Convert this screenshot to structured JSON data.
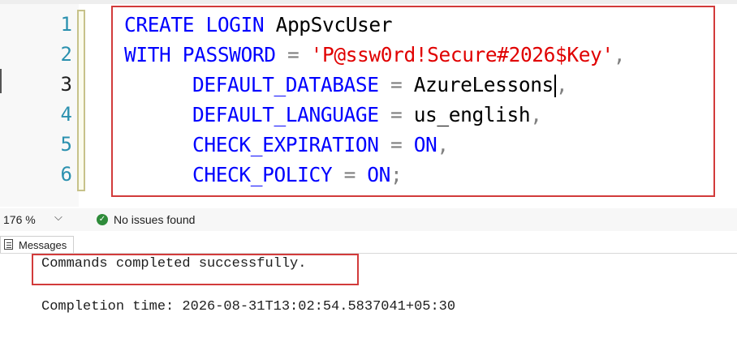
{
  "editor": {
    "line_numbers": [
      "1",
      "2",
      "3",
      "4",
      "5",
      "6"
    ],
    "current_line": "3",
    "lines": [
      {
        "kw1": "CREATE",
        "kw2": "LOGIN",
        "ident": "AppSvcUser"
      },
      {
        "kw1": "WITH",
        "kw2": "PASSWORD",
        "op": "=",
        "string": "'P@ssw0rd!Secure#2026$Key'",
        "comma": ","
      },
      {
        "option": "DEFAULT_DATABASE",
        "op": "=",
        "value": "AzureLessons",
        "comma": ","
      },
      {
        "option": "DEFAULT_LANGUAGE",
        "op": "=",
        "value": "us_english",
        "comma": ","
      },
      {
        "option": "CHECK_EXPIRATION",
        "op": "=",
        "value": "ON",
        "comma": ","
      },
      {
        "option": "CHECK_POLICY",
        "op": "=",
        "value": "ON",
        "terminator": ";"
      }
    ]
  },
  "status_bar": {
    "zoom": "176 %",
    "zoom_chevron": "⌵",
    "issues_icon_glyph": "✓",
    "issues_text": "No issues found"
  },
  "messages": {
    "tab_label": "Messages",
    "result_text": "Commands completed successfully.",
    "completion_text": "Completion time: 2026-08-31T13:02:54.5837041+05:30"
  },
  "colors": {
    "keyword": "#0000ff",
    "string": "#e00000",
    "operator": "#808080",
    "line_number": "#2b91af",
    "highlight_box": "#d23b3b",
    "success": "#2e8b3a"
  }
}
